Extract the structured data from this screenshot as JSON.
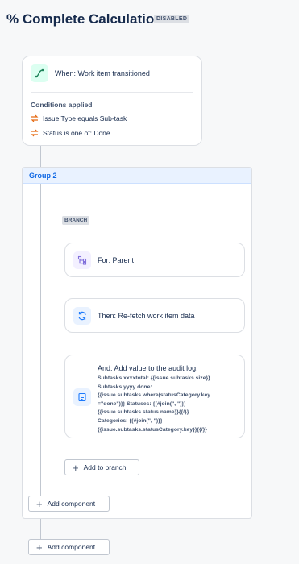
{
  "header": {
    "title": "% Complete Calculation",
    "status_badge": "DISABLED"
  },
  "trigger": {
    "label": "When: Work item transitioned",
    "conditions_title": "Conditions applied",
    "conditions": [
      "Issue Type equals Sub-task",
      "Status is one of: Done"
    ]
  },
  "group": {
    "title": "Group 2",
    "branch_tag": "BRANCH"
  },
  "actions": {
    "for_parent": "For: Parent",
    "refetch": "Then: Re-fetch work item data",
    "audit_title": "And: Add value to the audit log.",
    "audit_lines": [
      "Subtasks xxxxtotal: {{issue.subtasks.size}}",
      "Subtasks yyyy done:",
      "{{issue.subtasks.where(statusCategory.key",
      "=\"done\")}} Statuses: {{#join(\", \")}}",
      "{{issue.subtasks.status.name}}{{/}}",
      "Categories: {{#join(\", \")}}",
      "{{issue.subtasks.statusCategory.key}}{{/}}"
    ]
  },
  "buttons": {
    "add_to_branch": "Add to branch",
    "add_component_group": "Add component",
    "add_component_main": "Add component"
  },
  "icons": {
    "trigger": "transition-icon",
    "condition": "condition-swap-icon",
    "for_parent": "branch-parent-icon",
    "refetch": "refresh-icon",
    "audit": "audit-log-icon"
  }
}
